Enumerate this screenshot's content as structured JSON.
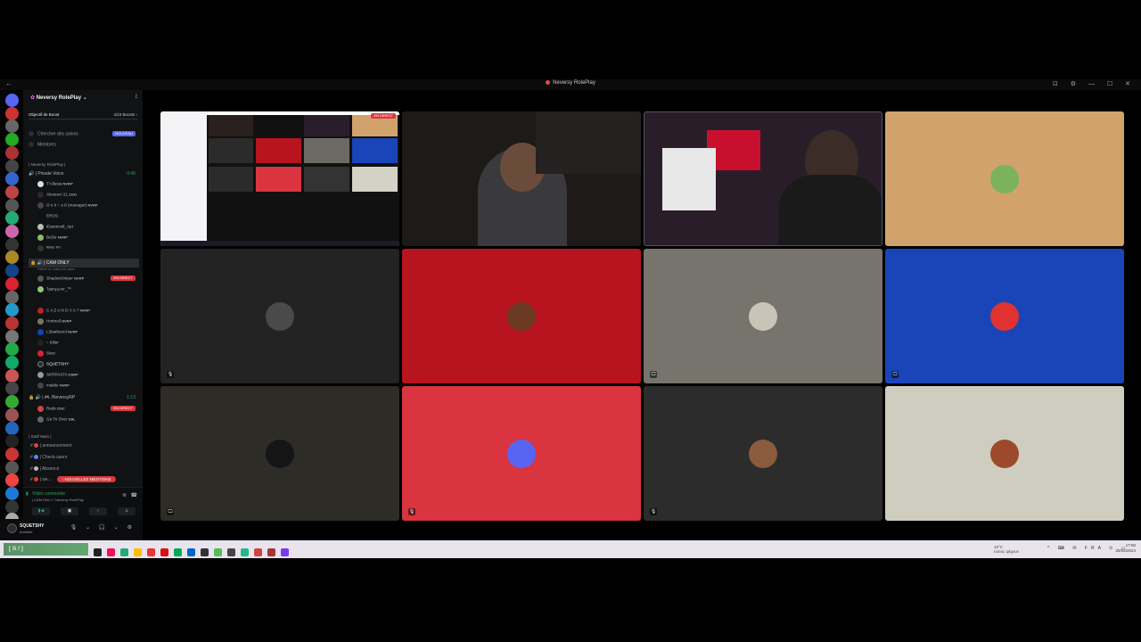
{
  "window": {
    "title": "Neversy RolePlay",
    "back": "←",
    "controls": "⊡ ⚙ — ☐ ✕"
  },
  "server": {
    "name": "Neversy RolePlay",
    "boost_label": "Objectif de Boost",
    "boost_count": "4/23 Boosts ›"
  },
  "nav": [
    {
      "label": "Chercher des salons",
      "badge": "NOUVEAU"
    },
    {
      "label": "Membres"
    }
  ],
  "categories": {
    "cat1": "| Neversy RolePlay |",
    "cat2": "| Staff Main |"
  },
  "voice_channels": {
    "private": {
      "name": "| Private Voice",
      "time": "0:46"
    },
    "cam": {
      "name": "| CAM ONLY",
      "desc": "Définir un statut de salon"
    },
    "neversy": {
      "name": "| 🎮 /NeversyRP",
      "time": "1:13"
    }
  },
  "private_users": [
    {
      "name": "T'Allusia",
      "tag": "NVRP"
    },
    {
      "name": "Alexeex! 21",
      "tag": "ZGO"
    },
    {
      "name": "O x X ↑ e 8 (manager)",
      "tag": "NVRP"
    },
    {
      "name": "EROS",
      "tag": ""
    },
    {
      "name": "iDaomnoll_Apt",
      "tag": ""
    },
    {
      "name": "BeDe",
      "tag": "NVRP"
    },
    {
      "name": "ᴿᴱᴬᴸᴱ ᴿᵀᵞ",
      "tag": ""
    }
  ],
  "cam_users": [
    {
      "name": "ShadowSniper",
      "tag": "NVRP",
      "live": "EN DIRECT"
    },
    {
      "name": "†ʂɕɾι℘℘ҽɾ_™",
      "tag": "",
      "live": ""
    },
    {
      "name": "...",
      "tag": "",
      "live": ""
    },
    {
      "name": "C A Z A N O V A ?",
      "tag": "NVRP",
      "live": ""
    },
    {
      "name": "Hortnell",
      "tag": "NVRP",
      "live": ""
    },
    {
      "name": "L3bathenol",
      "tag": "NVRP",
      "live": ""
    },
    {
      "name": "↑ Killer",
      "tag": "",
      "live": ""
    },
    {
      "name": "Siwo",
      "tag": "",
      "live": ""
    },
    {
      "name": "SQUETSHY",
      "tag": "",
      "live": ""
    },
    {
      "name": "SKRPASTA",
      "tag": "DSRP",
      "live": ""
    },
    {
      "name": "mabile",
      "tag": "NVRP",
      "live": ""
    }
  ],
  "neversy_users": [
    {
      "name": "Redo",
      "tag": "DSC",
      "live": "EN DIRECT"
    },
    {
      "name": "Go To Over",
      "tag": "DAL",
      "live": ""
    }
  ],
  "text_channels": [
    "| announcement",
    "| Check-users",
    "| Absence",
    "| we..."
  ],
  "mentions_pill": "↑ NOUVELLES MENTIONS",
  "voice_panel": {
    "status": "Vidéo connectée",
    "sub": "| CAM ONLY / Neversy RolePlay",
    "buttons": [
      "▮◀",
      "▣",
      "⁘",
      "♫"
    ]
  },
  "user": {
    "name": "SQUETSHY",
    "status": "Invisible",
    "icons": "🎙 ⌄ 🎧 ⌄ ⚙"
  },
  "stage": {
    "live_tag": "EN DIRECT",
    "tiles": [
      {
        "type": "screen",
        "bg": "#ffffff"
      },
      {
        "type": "camera",
        "bg": "#1d1a18"
      },
      {
        "type": "camera",
        "bg": "#2a1d2a"
      },
      {
        "type": "avatar",
        "bg": "#d2a26c",
        "avatar": "#7bb35c"
      },
      {
        "type": "avatar",
        "bg": "#232323",
        "avatar": "#4a4a4a",
        "mic": "🎙"
      },
      {
        "type": "avatar",
        "bg": "#b8141f",
        "avatar": "#6a3b22",
        "mic": ""
      },
      {
        "type": "avatar",
        "bg": "#77746d",
        "avatar": "#c9c4b8",
        "mic": "🖵"
      },
      {
        "type": "avatar",
        "bg": "#1a45b8",
        "avatar": "#e0322f",
        "mic": "🖵"
      },
      {
        "type": "avatar",
        "bg": "#2e2c27",
        "avatar": "#151515",
        "mic": "🖵"
      },
      {
        "type": "avatar",
        "bg": "#d9343f",
        "avatar": "#5865f2",
        "mic": "🎙"
      },
      {
        "type": "avatar",
        "bg": "#2c2c2c",
        "avatar": "#8a5b3c",
        "mic": "🎙"
      },
      {
        "type": "avatar",
        "bg": "#cfcdc0",
        "avatar": "#9c4a2b",
        "mic": ""
      }
    ]
  },
  "taskbar": {
    "logo": "[ ℝ ! ]",
    "weather_temp": "19°C",
    "weather_desc": "Ιοσιος ψέχουν",
    "tray": "^ ⌨ ✉ FRA ⊙ ▭",
    "time": "17:50",
    "date": "25/05/2024",
    "app_colors": [
      "#222",
      "#e15",
      "#2a7",
      "#fb0",
      "#e33",
      "#d11",
      "#0a5",
      "#06c",
      "#333",
      "#5b5",
      "#444",
      "#2b8",
      "#c44",
      "#a33",
      "#7c3aed"
    ]
  }
}
